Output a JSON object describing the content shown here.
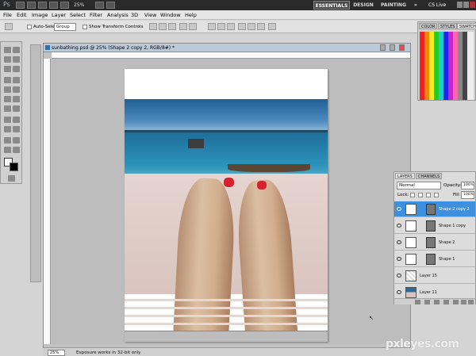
{
  "appbar": {
    "zoom": "25%",
    "workspaces": [
      "ESSENTIALS",
      "DESIGN",
      "PAINTING"
    ],
    "more": "»",
    "cs_live": "CS Live"
  },
  "menus": [
    "File",
    "Edit",
    "Image",
    "Layer",
    "Select",
    "Filter",
    "Analysis",
    "3D",
    "View",
    "Window",
    "Help"
  ],
  "options": {
    "auto_select_label": "Auto-Select:",
    "auto_select_value": "Group",
    "show_transform": "Show Transform Controls"
  },
  "document": {
    "tab_title": "sunbathing.psd @ 25% (Shape 2 copy 2, RGB/8#) *",
    "zoom": "25%",
    "status_message": "Exposure works in 32-bit only"
  },
  "swatch_panel": {
    "tabs": [
      "COLOR",
      "STYLES",
      "SWATCH"
    ]
  },
  "layers_panel": {
    "tabs": [
      "LAYERS",
      "CHANNELS"
    ],
    "blend_mode": "Normal",
    "opacity_label": "Opacity:",
    "opacity": "100%",
    "lock_label": "Lock:",
    "fill_label": "Fill:",
    "fill": "100%",
    "layers": [
      {
        "name": "Shape 2 copy 2",
        "selected": true
      },
      {
        "name": "Shape 1 copy",
        "selected": false
      },
      {
        "name": "Shape 2",
        "selected": false
      },
      {
        "name": "Shape 1",
        "selected": false
      },
      {
        "name": "Layer 15",
        "selected": false
      },
      {
        "name": "Layer 11",
        "selected": false
      }
    ]
  },
  "watermark": "pxleyes.com"
}
